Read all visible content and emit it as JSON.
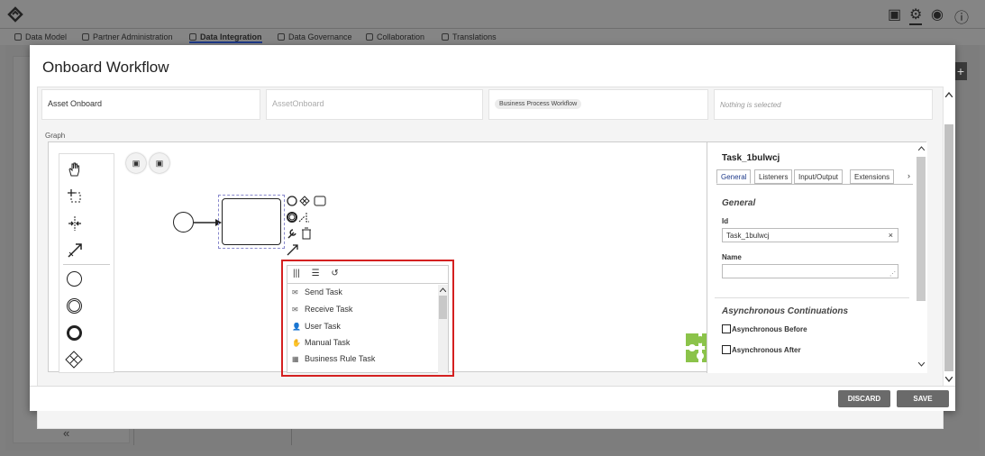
{
  "top_icons": {
    "save": "▣",
    "settings": "⚙",
    "user": "◉",
    "info": "ⓘ"
  },
  "nav_tabs": [
    "Data Model",
    "Partner Administration",
    "Data Integration",
    "Data Governance",
    "Collaboration",
    "Translations"
  ],
  "collapse_glyph": "«",
  "plus_glyph": "+",
  "modal": {
    "title": "Onboard Workflow",
    "fields": {
      "name": "Asset Onboard",
      "id_placeholder": "AssetOnboard",
      "type": "Business Process Workflow",
      "selection": "Nothing is selected"
    },
    "graph_label": "Graph",
    "palette_icons": [
      "hand-tool",
      "lasso-tool",
      "space-tool",
      "connect-tool",
      "start-event",
      "intermediate-event",
      "end-event",
      "gateway"
    ],
    "ctx_buttons": [
      "▣",
      "▣"
    ],
    "context_menu": {
      "head_icons": [
        "|||",
        "☰",
        "↺"
      ],
      "items": [
        {
          "icon": "✉",
          "label": "Send Task"
        },
        {
          "icon": "✉",
          "label": "Receive Task"
        },
        {
          "icon": "👤",
          "label": "User Task"
        },
        {
          "icon": "✋",
          "label": "Manual Task"
        },
        {
          "icon": "▦",
          "label": "Business Rule Task"
        }
      ]
    },
    "properties": {
      "title": "Task_1bulwcj",
      "tabs": [
        "General",
        "Listeners",
        "Input/Output",
        "Extensions"
      ],
      "more": "›",
      "section_general": "General",
      "id_label": "Id",
      "id_value": "Task_1bulwcj",
      "clear": "×",
      "name_label": "Name",
      "section_async": "Asynchronous Continuations",
      "async_before": "Asynchronous Before",
      "async_after": "Asynchronous After"
    },
    "buttons": {
      "discard": "DISCARD",
      "save": "SAVE"
    }
  }
}
